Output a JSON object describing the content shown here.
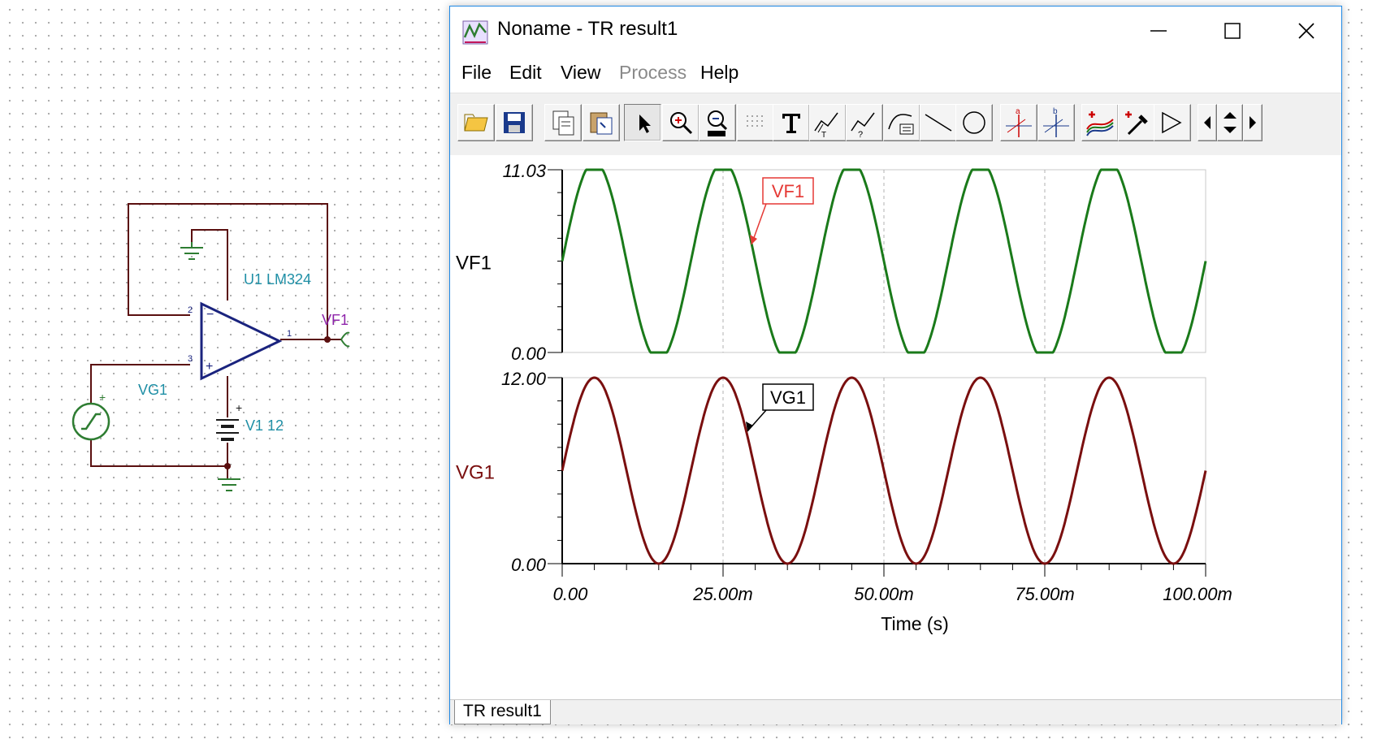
{
  "schematic": {
    "opamp_label": "U1 LM324",
    "output_probe": "VF1",
    "source_label": "VG1",
    "battery_label": "V1 12",
    "pin2": "2",
    "pin3": "3",
    "pin1": "1",
    "plus": "+",
    "minus": "−"
  },
  "window": {
    "title": "Noname - TR result1",
    "menu": [
      "File",
      "Edit",
      "View",
      "Process",
      "Help"
    ],
    "menu_disabled": [
      "Process"
    ],
    "controls": [
      "minimize",
      "maximize",
      "close"
    ],
    "toolbar_icons": [
      "open-icon",
      "save-icon",
      "copy-icon",
      "paste-icon",
      "pointer-icon",
      "zoom-in-icon",
      "zoom-100-icon",
      "grid-icon",
      "text-icon",
      "curve-label-icon",
      "curve-query-icon",
      "formula-icon",
      "line-icon",
      "circle-icon",
      "cursor-a-icon",
      "cursor-b-icon",
      "add-curve-icon",
      "pipette-icon",
      "triangle-icon",
      "nav-left-icon",
      "nav-updown-icon",
      "nav-right-icon"
    ],
    "status_tab": "TR result1"
  },
  "chart_data": [
    {
      "type": "line",
      "ylabel": "VF1",
      "ylim": [
        0,
        11.03
      ],
      "ytick_labels": [
        "11.03",
        "0.00"
      ],
      "series": [
        {
          "name": "VF1",
          "color": "#1a7a1a",
          "description_values": {
            "period_s": 0.02,
            "min": 0.0,
            "max": 11.03,
            "clipped_above": 11.03
          }
        }
      ],
      "annotation": "VF1",
      "x": [
        0,
        0.005,
        0.01,
        0.015,
        0.02,
        0.025,
        0.03,
        0.035,
        0.04,
        0.045,
        0.05,
        0.055,
        0.06,
        0.065,
        0.07,
        0.075,
        0.08,
        0.085,
        0.09,
        0.095,
        0.1
      ],
      "values": [
        5.9,
        11.03,
        6.5,
        0.0,
        5.9,
        11.03,
        6.5,
        0.0,
        5.9,
        11.03,
        6.5,
        0.0,
        5.9,
        11.03,
        6.5,
        0.0,
        5.9,
        11.03,
        6.5,
        0.0,
        5.9
      ]
    },
    {
      "type": "line",
      "ylabel": "VG1",
      "ylim": [
        0,
        12
      ],
      "ytick_labels": [
        "12.00",
        "0.00"
      ],
      "series": [
        {
          "name": "VG1",
          "color": "#7a0f0f",
          "description_values": {
            "period_s": 0.02,
            "min": 0.0,
            "max": 12.0
          }
        }
      ],
      "annotation": "VG1",
      "x": [
        0,
        0.005,
        0.01,
        0.015,
        0.02,
        0.025,
        0.03,
        0.035,
        0.04,
        0.045,
        0.05,
        0.055,
        0.06,
        0.065,
        0.07,
        0.075,
        0.08,
        0.085,
        0.09,
        0.095,
        0.1
      ],
      "values": [
        6,
        12,
        6,
        0,
        6,
        12,
        6,
        0,
        6,
        12,
        6,
        0,
        6,
        12,
        6,
        0,
        6,
        12,
        6,
        0,
        6
      ],
      "xlabel": "Time (s)",
      "xtick_labels": [
        "0.00",
        "25.00m",
        "50.00m",
        "75.00m",
        "100.00m"
      ],
      "xlim": [
        0,
        0.1
      ]
    }
  ]
}
